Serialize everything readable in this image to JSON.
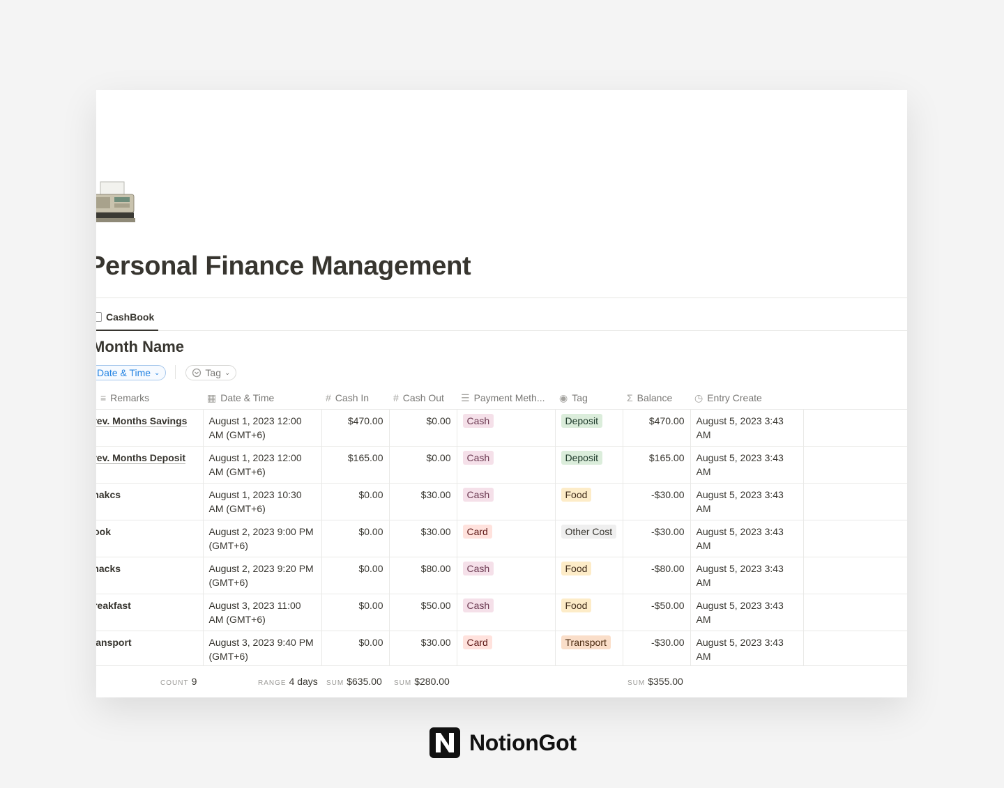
{
  "page": {
    "title": "Personal Finance Management",
    "icon": "fax-machine-icon"
  },
  "tabs": [
    {
      "label": "CashBook"
    }
  ],
  "view": {
    "title": "Month Name"
  },
  "filters": {
    "date_label": "Date & Time",
    "tag_label": "Tag"
  },
  "columns": [
    {
      "label": "Remarks",
      "icon": "text-icon"
    },
    {
      "label": "Date & Time",
      "icon": "calendar-icon"
    },
    {
      "label": "Cash In",
      "icon": "number-icon"
    },
    {
      "label": "Cash Out",
      "icon": "number-icon"
    },
    {
      "label": "Payment Meth...",
      "icon": "list-icon"
    },
    {
      "label": "Tag",
      "icon": "select-icon"
    },
    {
      "label": "Balance",
      "icon": "formula-icon"
    },
    {
      "label": "Entry Create",
      "icon": "clock-icon"
    }
  ],
  "rows": [
    {
      "remarks": "Prev. Months Savings",
      "date": "August 1, 2023 12:00 AM (GMT+6)",
      "cash_in": "$470.00",
      "cash_out": "$0.00",
      "payment": "Cash",
      "tag": "Deposit",
      "balance": "$470.00",
      "created": "August 5, 2023 3:43 AM"
    },
    {
      "remarks": "Prev. Months Deposit",
      "date": "August 1, 2023 12:00 AM (GMT+6)",
      "cash_in": "$165.00",
      "cash_out": "$0.00",
      "payment": "Cash",
      "tag": "Deposit",
      "balance": "$165.00",
      "created": "August 5, 2023 3:43 AM"
    },
    {
      "remarks": "Snakcs",
      "date": "August 1, 2023 10:30 AM (GMT+6)",
      "cash_in": "$0.00",
      "cash_out": "$30.00",
      "payment": "Cash",
      "tag": "Food",
      "balance": "-$30.00",
      "created": "August 5, 2023 3:43 AM"
    },
    {
      "remarks": "Book",
      "date": "August 2, 2023 9:00 PM (GMT+6)",
      "cash_in": "$0.00",
      "cash_out": "$30.00",
      "payment": "Card",
      "tag": "Other Cost",
      "balance": "-$30.00",
      "created": "August 5, 2023 3:43 AM"
    },
    {
      "remarks": "Snacks",
      "date": "August 2, 2023 9:20 PM (GMT+6)",
      "cash_in": "$0.00",
      "cash_out": "$80.00",
      "payment": "Cash",
      "tag": "Food",
      "balance": "-$80.00",
      "created": "August 5, 2023 3:43 AM"
    },
    {
      "remarks": "Breakfast",
      "date": "August 3, 2023 11:00 AM (GMT+6)",
      "cash_in": "$0.00",
      "cash_out": "$50.00",
      "payment": "Cash",
      "tag": "Food",
      "balance": "-$50.00",
      "created": "August 5, 2023 3:43 AM"
    },
    {
      "remarks": "Transport",
      "date": "August 3, 2023 9:40 PM (GMT+6)",
      "cash_in": "$0.00",
      "cash_out": "$30.00",
      "payment": "Card",
      "tag": "Transport",
      "balance": "-$30.00",
      "created": "August 5, 2023 3:43 AM"
    }
  ],
  "pill_colors": {
    "Cash": {
      "bg": "#f5e0e9",
      "fg": "#6c3a52"
    },
    "Card": {
      "bg": "#ffe2dd",
      "fg": "#5d1715"
    },
    "Deposit": {
      "bg": "#dbeddb",
      "fg": "#1c3829"
    },
    "Food": {
      "bg": "#fdecc8",
      "fg": "#402c1b"
    },
    "Other Cost": {
      "bg": "#efefef",
      "fg": "#37352f"
    },
    "Transport": {
      "bg": "#fadec9",
      "fg": "#49290e"
    }
  },
  "footer": {
    "count_key": "COUNT",
    "count_val": "9",
    "range_key": "RANGE",
    "range_val": "4 days",
    "sum_in_key": "SUM",
    "sum_in_val": "$635.00",
    "sum_out_key": "SUM",
    "sum_out_val": "$280.00",
    "sum_bal_key": "SUM",
    "sum_bal_val": "$355.00"
  },
  "brand": {
    "name": "NotionGot",
    "logo": "notion-n-logo"
  }
}
